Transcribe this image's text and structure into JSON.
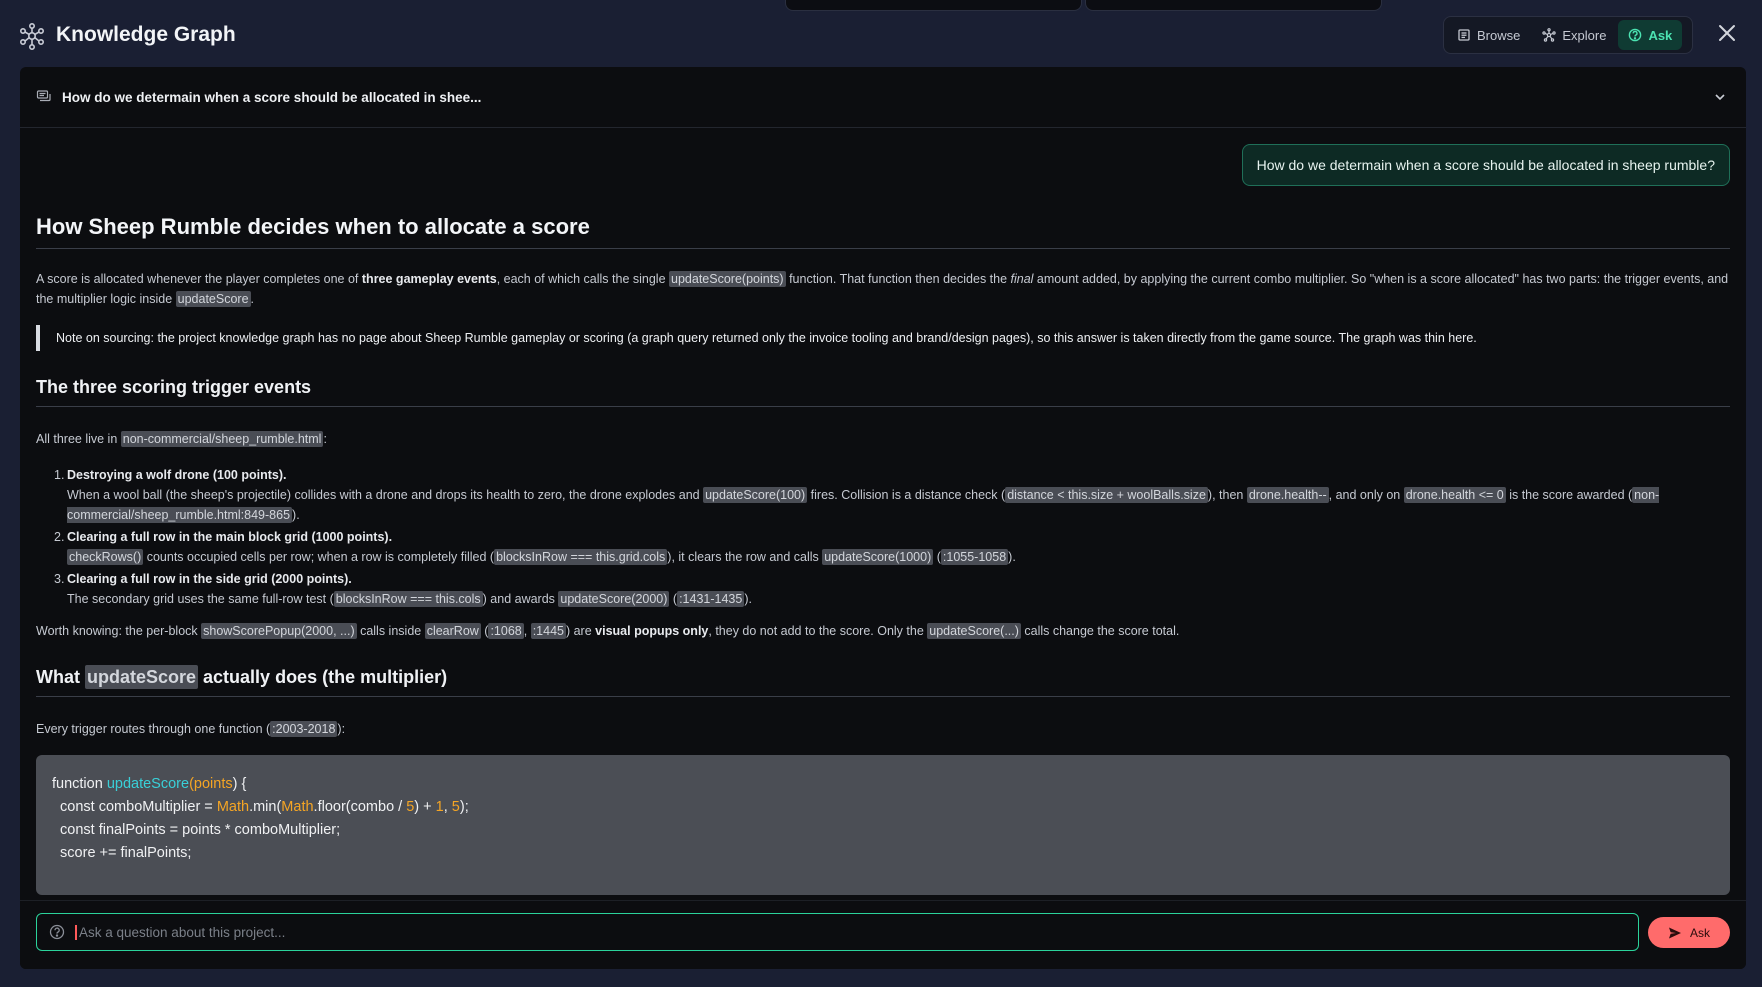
{
  "app": {
    "title": "Knowledge Graph"
  },
  "modes": [
    {
      "label": "Browse",
      "icon": "book-icon",
      "active": false
    },
    {
      "label": "Explore",
      "icon": "network-icon",
      "active": false
    },
    {
      "label": "Ask",
      "icon": "question-circle-icon",
      "active": true
    }
  ],
  "conversation": {
    "title": "How do we determain when a score should be allocated in shee...",
    "user_message": "How do we determain when a score should be allocated in sheep rumble?"
  },
  "answer": {
    "h1": "How Sheep Rumble decides when to allocate a score",
    "intro": {
      "t1": "A score is allocated whenever the player completes one of ",
      "b1": "three gameplay events",
      "t2": ", each of which calls the single ",
      "c1": "updateScore(points)",
      "t3": " function. That function then decides the ",
      "i1": "final",
      "t4": " amount added, by applying the current combo multiplier. So \"when is a score allocated\" has two parts: the trigger events, and the multiplier logic inside ",
      "c2": "updateScore",
      "t5": "."
    },
    "note": "Note on sourcing: the project knowledge graph has no page about Sheep Rumble gameplay or scoring (a graph query returned only the invoice tooling and brand/design pages), so this answer is taken directly from the game source. The graph was thin here.",
    "h2_triggers": "The three scoring trigger events",
    "triggers_intro": {
      "t1": "All three live in ",
      "c1": "non-commercial/sheep_rumble.html",
      "t2": ":"
    },
    "events": [
      {
        "num": "1.",
        "title": "Destroying a wolf drone (100 points).",
        "d1": "When a wool ball (the sheep's projectile) collides with a drone and drops its health to zero, the drone explodes and ",
        "c1": "updateScore(100)",
        "d2": " fires. Collision is a distance check (",
        "c2": "distance < this.size + woolBalls.size",
        "d3": "), then ",
        "c3": "drone.health--",
        "d4": ", and only on ",
        "c4": "drone.health <= 0",
        "d5": " is the score awarded (",
        "c5": "non-commercial/sheep_rumble.html:849-865",
        "d6": ")."
      },
      {
        "num": "2.",
        "title": "Clearing a full row in the main block grid (1000 points).",
        "c1": "checkRows()",
        "d1": " counts occupied cells per row; when a row is completely filled (",
        "c2": "blocksInRow === this.grid.cols",
        "d2": "), it clears the row and calls ",
        "c3": "updateScore(1000)",
        "d3": " (",
        "c4": ":1055-1058",
        "d4": ")."
      },
      {
        "num": "3.",
        "title": "Clearing a full row in the side grid (2000 points).",
        "d1": "The secondary grid uses the same full-row test (",
        "c1": "blocksInRow === this.cols",
        "d2": ") and awards ",
        "c2": "updateScore(2000)",
        "d3": " (",
        "c3": ":1431-1435",
        "d4": ")."
      }
    ],
    "worth": {
      "t1": "Worth knowing: the per-block ",
      "c1": "showScorePopup(2000, ...)",
      "t2": " calls inside ",
      "c2": "clearRow",
      "t3": " (",
      "c3": ":1068",
      "t4": ", ",
      "c4": ":1445",
      "t5": ") are ",
      "b1": "visual popups only",
      "t6": ", they do not add to the score. Only the ",
      "c5": "updateScore(...)",
      "t7": " calls change the score total."
    },
    "h2_update": {
      "t1": "What ",
      "c1": "updateScore",
      "t2": " actually does (the multiplier)"
    },
    "update_intro": {
      "t1": "Every trigger routes through one function (",
      "c1": ":2003-2018",
      "t2": "):"
    },
    "code": {
      "l1_kw": "function ",
      "l1_fn": "updateScore",
      "l1_p1": "(",
      "l1_arg": "points",
      "l1_p2": ") {",
      "l2_a": "  const comboMultiplier = ",
      "l2_cls1": "Math",
      "l2_b": ".min(",
      "l2_cls2": "Math",
      "l2_c": ".floor(combo / ",
      "l2_n1": "5",
      "l2_d": ") + ",
      "l2_n2": "1",
      "l2_e": ", ",
      "l2_n3": "5",
      "l2_f": ");",
      "l3": "  const finalPoints = points * comboMultiplier;",
      "l4": "  score += finalPoints;"
    }
  },
  "input": {
    "placeholder": "Ask a question about this project...",
    "value": ""
  },
  "ask_button": {
    "label": "Ask"
  },
  "colors": {
    "accent": "#2bd39b",
    "ask_button": "#ff6b6b",
    "background": "#1a1f33",
    "panel": "#0c0d10"
  }
}
